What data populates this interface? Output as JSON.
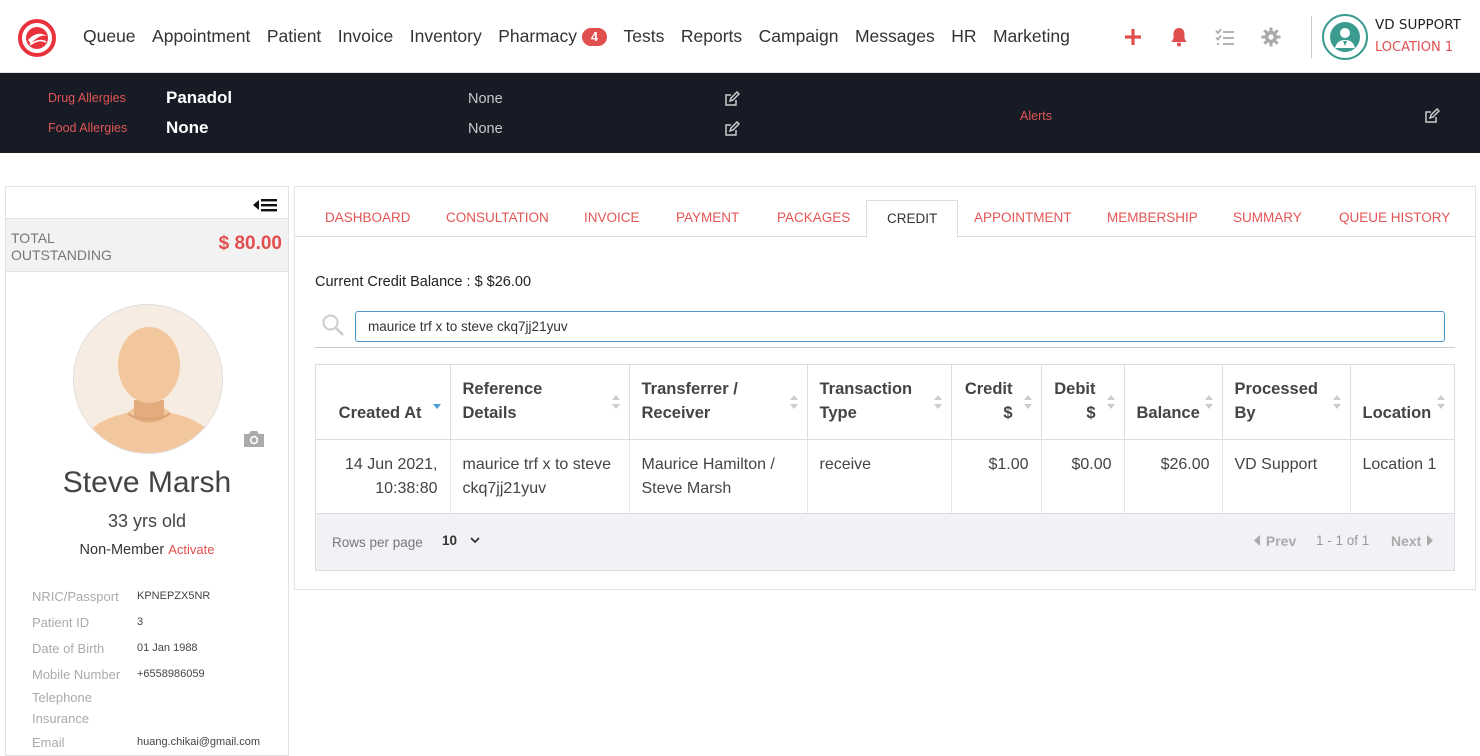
{
  "nav": {
    "items": [
      {
        "label": "Queue"
      },
      {
        "label": "Appointment"
      },
      {
        "label": "Patient"
      },
      {
        "label": "Invoice"
      },
      {
        "label": "Inventory"
      },
      {
        "label": "Pharmacy",
        "badge": "4"
      },
      {
        "label": "Tests"
      },
      {
        "label": "Reports"
      },
      {
        "label": "Campaign"
      },
      {
        "label": "Messages"
      },
      {
        "label": "HR"
      },
      {
        "label": "Marketing"
      }
    ],
    "user_name": "VD SUPPORT",
    "user_location": "LOCATION 1",
    "colors": {
      "accent": "#e04e4e",
      "avatar_ring": "#3b9b8f"
    }
  },
  "allergies": {
    "drug_label": "Drug Allergies",
    "drug_value": "Panadol",
    "drug_note": "None",
    "food_label": "Food Allergies",
    "food_value": "None",
    "food_note": "None",
    "alerts_label": "Alerts"
  },
  "patient": {
    "outstanding_label": "Total Outstanding",
    "outstanding_value": "$ 80.00",
    "name": "Steve Marsh",
    "age": "33 yrs old",
    "membership": "Non-Member",
    "activate_label": "Activate",
    "info": [
      {
        "label": "NRIC/Passport",
        "value": "KPNEPZX5NR"
      },
      {
        "label": "Patient ID",
        "value": "3"
      },
      {
        "label": "Date of Birth",
        "value": "01 Jan 1988"
      },
      {
        "label": "Mobile Number",
        "value": "+6558986059"
      },
      {
        "label": "Telephone",
        "value": ""
      },
      {
        "label": "Insurance",
        "value": ""
      },
      {
        "label": "Email",
        "value": "huang.chikai@gmail.com"
      }
    ]
  },
  "tabs": [
    {
      "label": "Dashboard"
    },
    {
      "label": "Consultation"
    },
    {
      "label": "Invoice"
    },
    {
      "label": "Payment"
    },
    {
      "label": "Packages"
    },
    {
      "label": "Credit",
      "active": true
    },
    {
      "label": "Appointment"
    },
    {
      "label": "Membership"
    },
    {
      "label": "Summary"
    },
    {
      "label": "Queue History"
    }
  ],
  "credit": {
    "balance_text": "Current Credit Balance : $ $26.00",
    "search_value": "maurice trf x to steve ckq7jj21yuv",
    "columns": [
      "Created At",
      "Reference Details",
      "Transferrer / Receiver",
      "Transaction Type",
      "Credit $",
      "Debit $",
      "Balance",
      "Processed By",
      "Location"
    ],
    "rows": [
      {
        "created_at": "14 Jun 2021, 10:38:80",
        "reference": "maurice trf x to steve ckq7jj21yuv",
        "transferrer": "Maurice Hamilton / Steve Marsh",
        "type": "receive",
        "credit": "$1.00",
        "debit": "$0.00",
        "balance": "$26.00",
        "processed_by": "VD Support",
        "location": "Location 1"
      }
    ],
    "rows_per_page_label": "Rows per page",
    "rows_per_page_value": "10",
    "prev_label": "Prev",
    "range_label": "1 - 1 of 1",
    "next_label": "Next"
  }
}
